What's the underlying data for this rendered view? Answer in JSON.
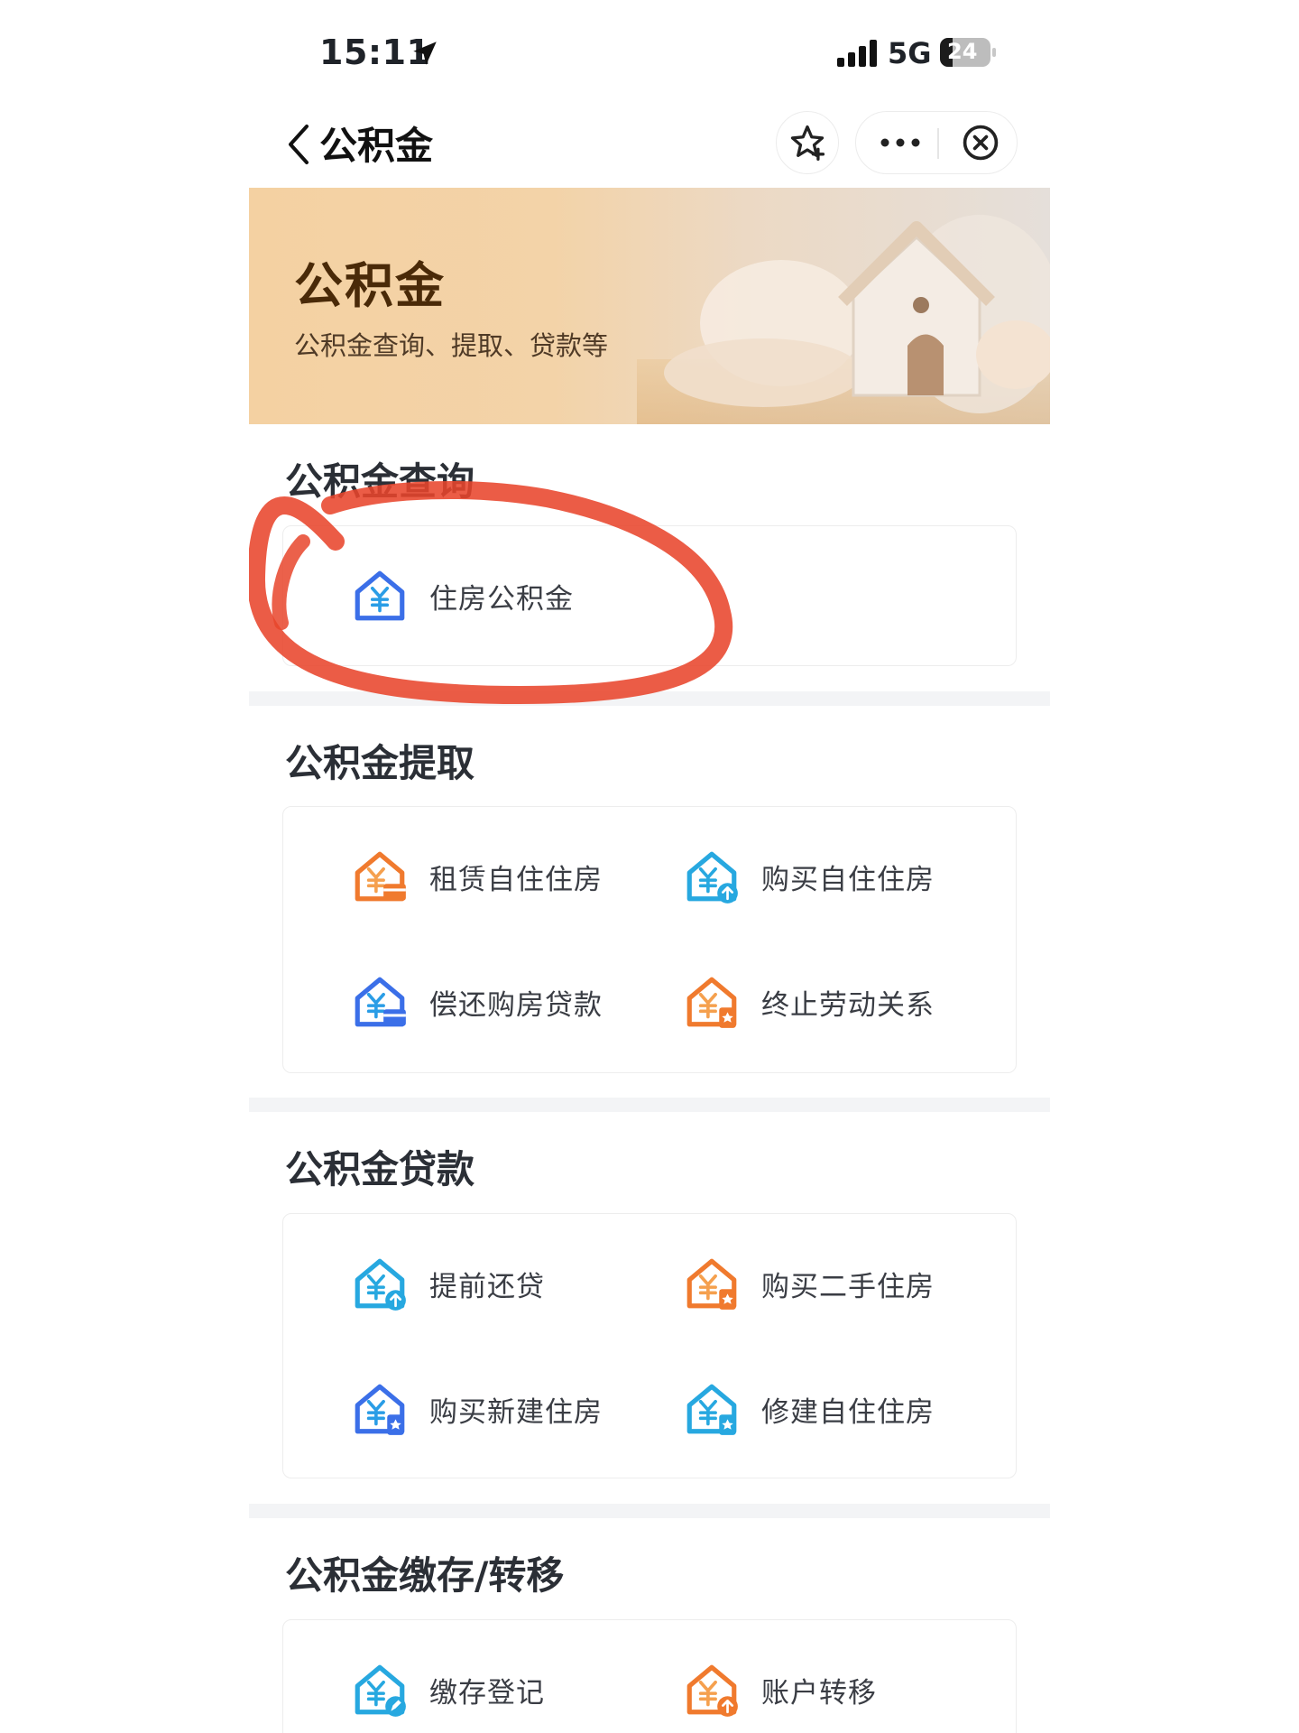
{
  "status_bar": {
    "time": "15:11",
    "network": "5G",
    "battery": "24"
  },
  "nav": {
    "title": "公积金"
  },
  "banner": {
    "title": "公积金",
    "subtitle": "公积金查询、提取、贷款等"
  },
  "sections": [
    {
      "title": "公积金查询",
      "items": [
        {
          "label": "住房公积金",
          "icon": "house-yuan-icon"
        }
      ]
    },
    {
      "title": "公积金提取",
      "items": [
        {
          "label": "租赁自住住房",
          "icon": "house-yuan-card-icon"
        },
        {
          "label": "购买自住住房",
          "icon": "house-yuan-up-icon"
        },
        {
          "label": "偿还购房贷款",
          "icon": "house-yuan-card-icon"
        },
        {
          "label": "终止劳动关系",
          "icon": "house-yuan-doc-icon"
        }
      ]
    },
    {
      "title": "公积金贷款",
      "items": [
        {
          "label": "提前还贷",
          "icon": "house-yuan-up-icon"
        },
        {
          "label": "购买二手住房",
          "icon": "house-yuan-doc-icon"
        },
        {
          "label": "购买新建住房",
          "icon": "house-yuan-doc-icon"
        },
        {
          "label": "修建自住住房",
          "icon": "house-yuan-doc-icon"
        }
      ]
    },
    {
      "title": "公积金缴存/转移",
      "items": [
        {
          "label": "缴存登记",
          "icon": "house-yuan-edit-icon"
        },
        {
          "label": "账户转移",
          "icon": "house-yuan-up-icon"
        }
      ]
    }
  ],
  "colors": {
    "blue": "#3b6fe8",
    "cyan": "#27a8e0",
    "orange": "#f07a2e",
    "annotation": "#e8452c"
  }
}
